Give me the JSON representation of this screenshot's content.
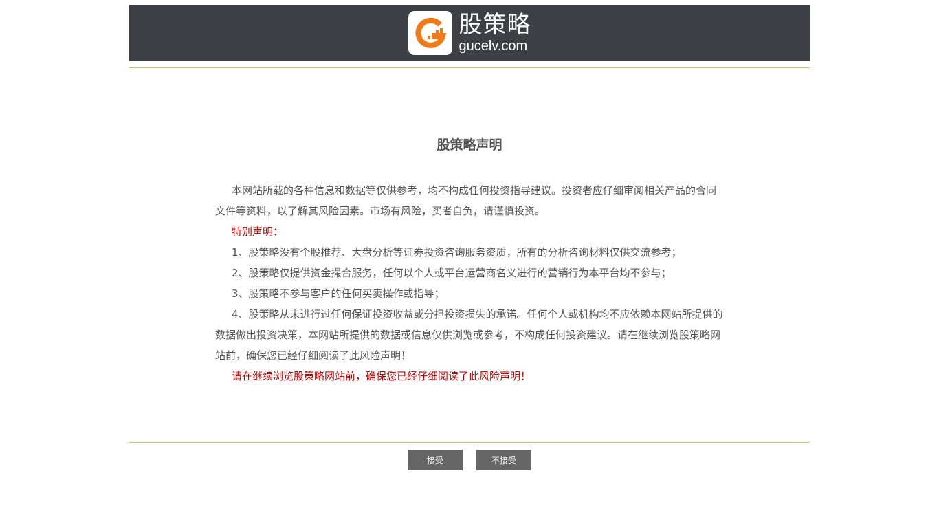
{
  "header": {
    "logo_cn": "股策略",
    "logo_en": "gucelv.com",
    "logo_mark_letter": "G",
    "colors": {
      "header_bg": "#3d4145",
      "logo_orange": "#f07a1a",
      "rule": "#d8c050",
      "accent_red": "#cc0000"
    }
  },
  "statement": {
    "title": "股策略声明",
    "paragraphs": [
      {
        "text": "本网站所载的各种信息和数据等仅供参考，均不构成任何投资指导建议。投资者应仔细审阅相关产品的合同文件等资料，以了解其风险因素。市场有风险，买者自负，请谨慎投资。",
        "red": false
      },
      {
        "text": "特别声明：",
        "red": true
      },
      {
        "text": "1、股策略没有个股推荐、大盘分析等证券投资咨询服务资质，所有的分析咨询材料仅供交流参考；",
        "red": false
      },
      {
        "text": "2、股策略仅提供资金撮合服务，任何以个人或平台运营商名义进行的营销行为本平台均不参与；",
        "red": false
      },
      {
        "text": "3、股策略不参与客户的任何买卖操作或指导；",
        "red": false
      },
      {
        "text": "4、股策略从未进行过任何保证投资收益或分担投资损失的承诺。任何个人或机构均不应依赖本网站所提供的数据做出投资决策，本网站所提供的数据或信息仅供浏览或参考，不构成任何投资建议。请在继续浏览股策略网站前，确保您已经仔细阅读了此风险声明！",
        "red": false
      },
      {
        "text": "请在继续浏览股策略网站前，确保您已经仔细阅读了此风险声明！",
        "red": true
      }
    ]
  },
  "buttons": {
    "accept": "接受",
    "decline": "不接受"
  }
}
